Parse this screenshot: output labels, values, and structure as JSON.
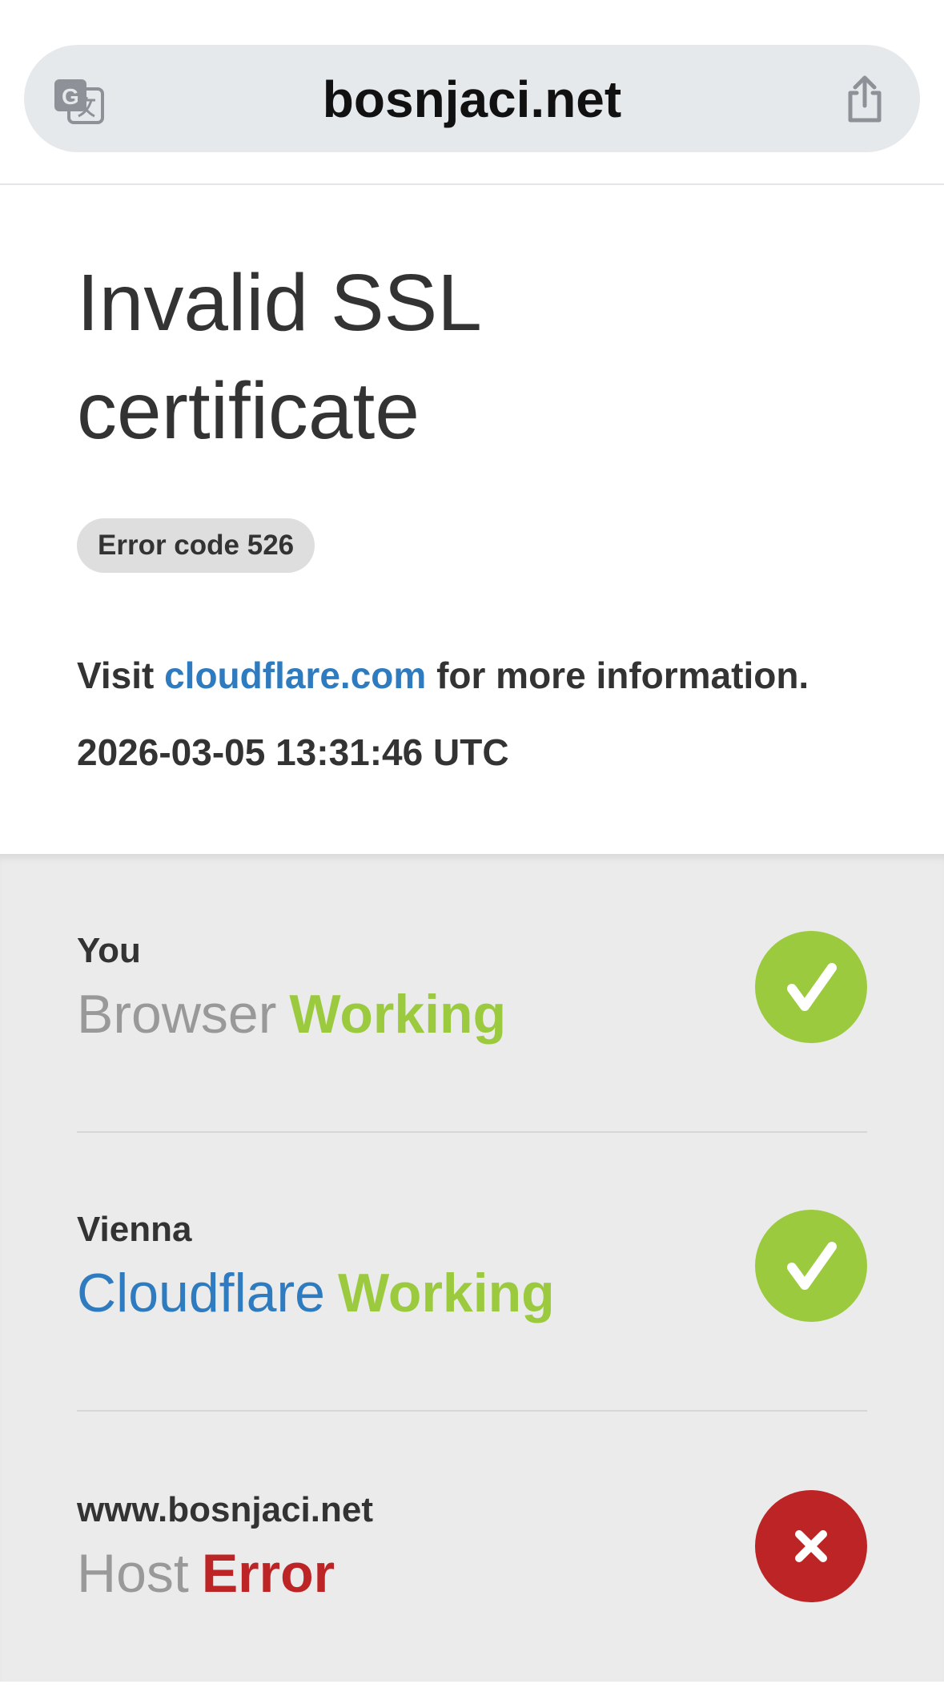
{
  "browser": {
    "url": "bosnjaci.net",
    "translate_icon": "translate-icon",
    "share_icon": "share-icon"
  },
  "error": {
    "title": "Invalid SSL certificate",
    "code_label": "Error code 526",
    "info_prefix": "Visit",
    "info_link": "cloudflare.com",
    "info_suffix": "for more information.",
    "timestamp": "2026-03-05 13:31:46 UTC"
  },
  "status": {
    "items": [
      {
        "location": "You",
        "name": "Browser",
        "state": "Working",
        "ok": true,
        "icon": "check-icon"
      },
      {
        "location": "Vienna",
        "name": "Cloudflare",
        "state": "Working",
        "ok": true,
        "icon": "check-icon"
      },
      {
        "location": "www.bosnjaci.net",
        "name": "Host",
        "state": "Error",
        "ok": false,
        "icon": "close-icon"
      }
    ]
  },
  "colors": {
    "ok": "#9bca3e",
    "error": "#bd2426",
    "link": "#2f7bbf",
    "text": "#333333"
  }
}
